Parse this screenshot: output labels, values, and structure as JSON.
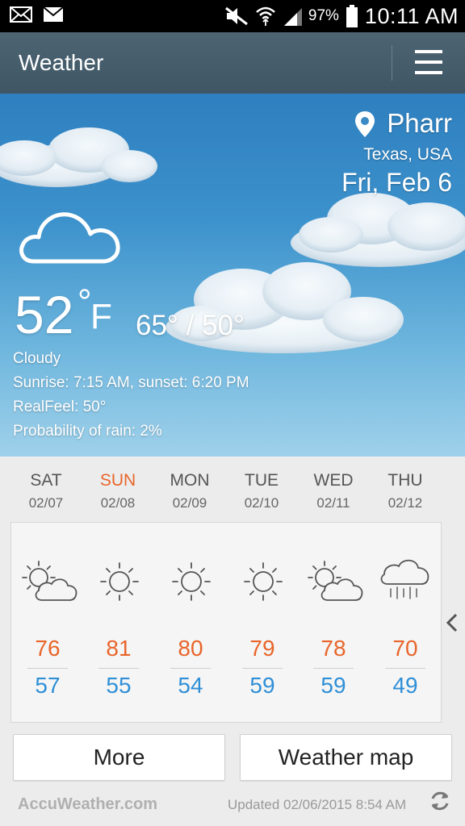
{
  "status_bar": {
    "battery": "97%",
    "time": "10:11 AM",
    "icons": [
      "gmail-icon",
      "mail-icon",
      "mute-icon",
      "wifi-icon",
      "signal-icon",
      "battery-icon"
    ]
  },
  "app_bar": {
    "title": "Weather",
    "menu_icon": "hamburger-menu-icon"
  },
  "current": {
    "city": "Pharr",
    "region": "Texas, USA",
    "date": "Fri, Feb 6",
    "temp": "52",
    "unit_symbol": "°",
    "unit": "F",
    "hi_lo": "65° / 50°",
    "condition": "Cloudy",
    "sun_times": "Sunrise: 7:15  AM, sunset: 6:20  PM",
    "real_feel": "RealFeel: 50°",
    "rain_prob": "Probability of rain: 2%",
    "icon": "cloudy-icon"
  },
  "forecast": [
    {
      "day": "SAT",
      "date": "02/07",
      "icon": "partly-cloudy-icon",
      "high": "76",
      "low": "57"
    },
    {
      "day": "SUN",
      "date": "02/08",
      "icon": "sunny-icon",
      "high": "81",
      "low": "55"
    },
    {
      "day": "MON",
      "date": "02/09",
      "icon": "sunny-icon",
      "high": "80",
      "low": "54"
    },
    {
      "day": "TUE",
      "date": "02/10",
      "icon": "sunny-icon",
      "high": "79",
      "low": "59"
    },
    {
      "day": "WED",
      "date": "02/11",
      "icon": "partly-cloudy-icon",
      "high": "78",
      "low": "59"
    },
    {
      "day": "THU",
      "date": "02/12",
      "icon": "rain-icon",
      "high": "70",
      "low": "49"
    }
  ],
  "buttons": {
    "more": "More",
    "weather_map": "Weather map"
  },
  "footer": {
    "brand": "AccuWeather.com",
    "updated": "Updated 02/06/2015 8:54 AM"
  },
  "colors": {
    "high_temp": "#e8652a",
    "low_temp": "#2f8fd6",
    "app_bar": "#46606f"
  }
}
